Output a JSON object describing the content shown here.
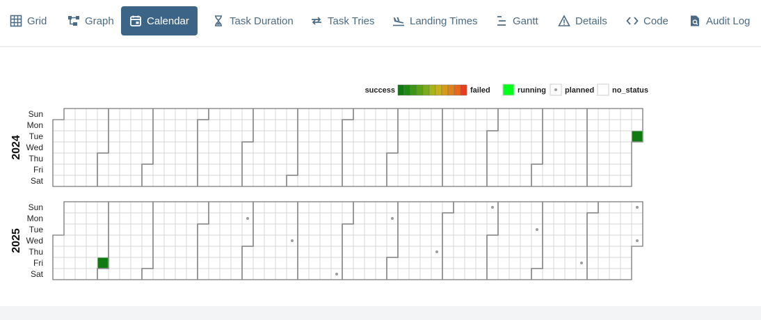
{
  "nav": {
    "tabs": [
      {
        "label": "Grid",
        "icon": "grid-icon",
        "active": false
      },
      {
        "label": "Graph",
        "icon": "graph-icon",
        "active": false
      },
      {
        "label": "Calendar",
        "icon": "calendar-icon",
        "active": true
      },
      {
        "label": "Task Duration",
        "icon": "hourglass-icon",
        "active": false
      },
      {
        "label": "Task Tries",
        "icon": "retry-arrows-icon",
        "active": false
      },
      {
        "label": "Landing Times",
        "icon": "plane-landing-icon",
        "active": false
      },
      {
        "label": "Gantt",
        "icon": "gantt-icon",
        "active": false
      },
      {
        "label": "Details",
        "icon": "warning-triangle-icon",
        "active": false
      },
      {
        "label": "Code",
        "icon": "code-icon",
        "active": false
      },
      {
        "label": "Audit Log",
        "icon": "audit-file-icon",
        "active": false
      }
    ]
  },
  "legend": {
    "success_label": "success",
    "failed_label": "failed",
    "running_label": "running",
    "planned_label": "planned",
    "no_status_label": "no_status",
    "gradient_colors": [
      "#0f7a0f",
      "#1f8a10",
      "#3b9612",
      "#5aa314",
      "#7bad16",
      "#a7b518",
      "#c8b01a",
      "#d69a1a",
      "#de831b",
      "#e5681c",
      "#ea3d1e"
    ],
    "running_color": "#00ff1a",
    "no_status_color": "#ffffff"
  },
  "calendar": {
    "weekdays": [
      "Sun",
      "Mon",
      "Tue",
      "Wed",
      "Thu",
      "Fri",
      "Sat"
    ],
    "years": [
      {
        "year": "2024",
        "success_dates": [
          "2024-12-31"
        ],
        "planned_dates": []
      },
      {
        "year": "2025",
        "success_dates": [
          "2025-01-31"
        ],
        "planned_dates": [
          "2025-04-28",
          "2025-05-28",
          "2025-06-28",
          "2025-07-28",
          "2025-08-28",
          "2025-09-28",
          "2025-10-28",
          "2025-11-28",
          "2025-12-28",
          "2025-12-31"
        ]
      }
    ],
    "colors": {
      "success": "#0f7a0f",
      "cell_border": "#d6d6d6",
      "month_border": "#8f8f8f",
      "planned_dot": "#9b9b9b"
    }
  }
}
